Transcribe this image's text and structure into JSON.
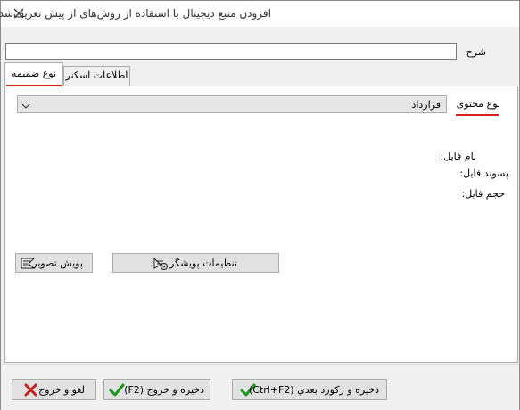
{
  "window": {
    "title": "افزودن منبع دیجیتال با استفاده از روش‌های از پیش تعریف‌شده"
  },
  "description": {
    "label": "شرح",
    "value": ""
  },
  "tabs": [
    {
      "label": "نوع ضمیمه",
      "active": true
    },
    {
      "label": "اطلاعات اسکنر",
      "active": false
    }
  ],
  "content_type": {
    "label": "نوع محتوی",
    "selected": "قرارداد"
  },
  "file_info": {
    "name_label": "نام فایل:",
    "extension_label": "پسوند فایل:",
    "size_label": "حجم فایل:"
  },
  "scanner_buttons": {
    "settings_label": "تنظیمات پویشگر",
    "scan_label": "پویش تصویر"
  },
  "footer_buttons": {
    "save_next_label": "ذخیره و رکورد بعدي (Ctrl+F2)",
    "save_exit_label": "ذخیره و خروج (F2)",
    "cancel_label": "لغو و خروج"
  },
  "colors": {
    "accent_underline": "#d52020",
    "check_green": "#1a9a1a",
    "cancel_red": "#c81e1e"
  },
  "icons": [
    "close-icon",
    "chevron-down-icon",
    "scanner-settings-icon",
    "scanner-icon",
    "check-icon",
    "cross-icon"
  ]
}
